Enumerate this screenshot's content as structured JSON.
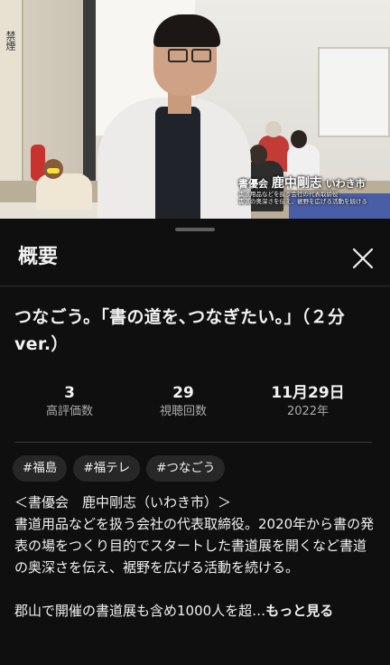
{
  "video": {
    "sign_text": "禁煙",
    "caption": {
      "org": "書優会",
      "name": "鹿中剛志",
      "place": "いわき市",
      "line1": "書道用品などを扱う会社の代表取締役",
      "line2": "書道の奥深さを伝え、裾野を広げる活動を続ける"
    }
  },
  "panel": {
    "title": "概要",
    "close_icon": "close-icon"
  },
  "video_title": "つなごう。「書の道を､つなぎたい。」（２分ver.）",
  "stats": [
    {
      "value": "3",
      "label": "高評価数"
    },
    {
      "value": "29",
      "label": "視聴回数"
    },
    {
      "value": "11月29日",
      "label": "2022年"
    }
  ],
  "tags": [
    "#福島",
    "#福テレ",
    "#つなごう"
  ],
  "description": {
    "line_header": "＜書優会　鹿中剛志（いわき市）＞",
    "paragraph1": "書道用品などを扱う会社の代表取締役。2020年から書の発表の場をつくり目的でスタートした書道展を開くなど書道の奥深さを伝え、裾野を広げる活動を続ける。",
    "paragraph2": "郡山で開催の書道展も含め1000人を超…",
    "more_label": "もっと見る"
  },
  "colors": {
    "background": "#0f0f0f",
    "chip": "#272727",
    "secondary_text": "#aaaaaa"
  }
}
